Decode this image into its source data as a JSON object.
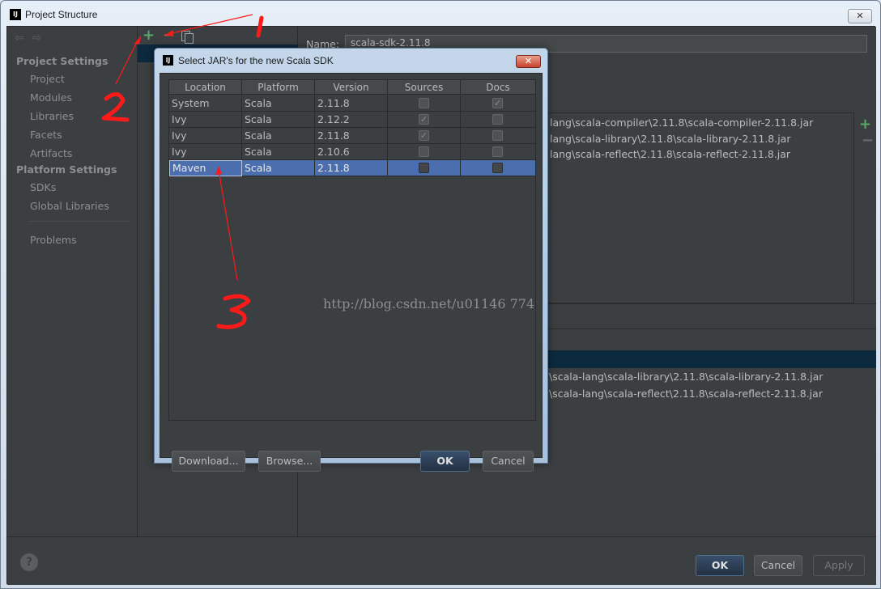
{
  "window": {
    "title": "Project Structure",
    "close": "✕",
    "logo": "IJ"
  },
  "nav": {
    "back_icon": "arrow-left-icon",
    "forward_icon": "arrow-right-icon",
    "project_settings": "Project Settings",
    "project_items": [
      "Project",
      "Modules",
      "Libraries",
      "Facets",
      "Artifacts"
    ],
    "platform_settings": "Platform Settings",
    "platform_items": [
      "SDKs",
      "Global Libraries"
    ],
    "problems": "Problems"
  },
  "toolbar": {
    "add": "+",
    "remove": "−"
  },
  "details": {
    "name_label": "Name:",
    "name_value": "scala-sdk-2.11.8",
    "classes": [
      "lang\\scala-compiler\\2.11.8\\scala-compiler-2.11.8.jar",
      "lang\\scala-library\\2.11.8\\scala-library-2.11.8.jar",
      "lang\\scala-reflect\\2.11.8\\scala-reflect-2.11.8.jar"
    ],
    "side_add": "+",
    "side_remove": "−",
    "lower_paths": [
      "\\scala-lang\\scala-library\\2.11.8\\scala-library-2.11.8.jar",
      "\\scala-lang\\scala-reflect\\2.11.8\\scala-reflect-2.11.8.jar"
    ]
  },
  "buttons": {
    "ok": "OK",
    "cancel": "Cancel",
    "apply": "Apply",
    "help": "?"
  },
  "dialog": {
    "logo": "IJ",
    "title": "Select JAR's for the new Scala SDK",
    "close": "✕",
    "columns": [
      "Location",
      "Platform",
      "Version",
      "Sources",
      "Docs"
    ],
    "rows": [
      {
        "location": "System",
        "platform": "Scala",
        "version": "2.11.8",
        "sources": false,
        "docs": true
      },
      {
        "location": "Ivy",
        "platform": "Scala",
        "version": "2.12.2",
        "sources": true,
        "docs": false
      },
      {
        "location": "Ivy",
        "platform": "Scala",
        "version": "2.11.8",
        "sources": true,
        "docs": false
      },
      {
        "location": "Ivy",
        "platform": "Scala",
        "version": "2.10.6",
        "sources": false,
        "docs": false
      },
      {
        "location": "Maven",
        "platform": "Scala",
        "version": "2.11.8",
        "sources": false,
        "docs": false,
        "selected": true
      }
    ],
    "download": "Download...",
    "browse": "Browse...",
    "ok": "OK",
    "cancel": "Cancel"
  },
  "annotations": {
    "one": "1",
    "two": "2",
    "three": "3",
    "color": "#ff1a1a"
  },
  "watermark": "http://blog.csdn.net/u01146 774",
  "colors": {
    "bg": "#3c3f41",
    "selection": "#4b6eaf",
    "add_green": "#59a869",
    "remove_red": "#c75450"
  }
}
